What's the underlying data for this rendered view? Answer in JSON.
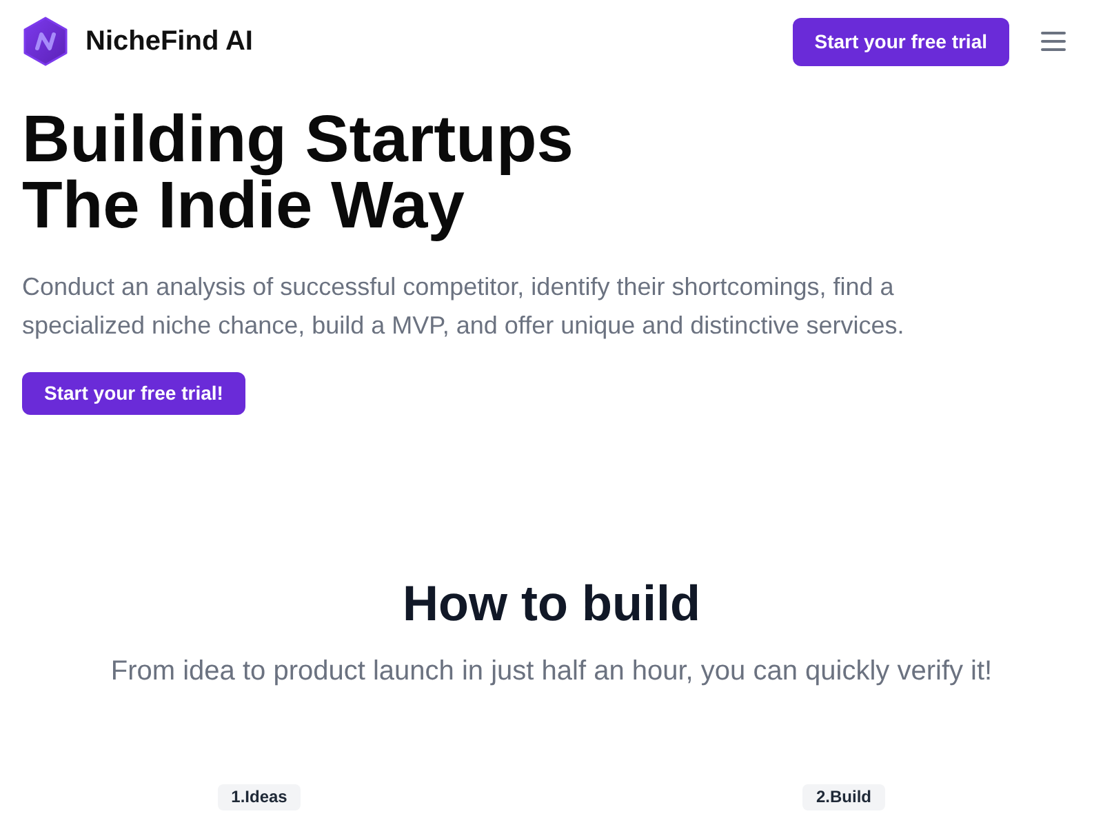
{
  "header": {
    "brand": "NicheFind AI",
    "cta": "Start your free trial"
  },
  "hero": {
    "title_lines": [
      "Building Startups",
      "The Indie Way"
    ],
    "description": "Conduct an analysis of successful competitor, identify their shortcomings, find a specialized niche chance, build a MVP, and offer unique and distinctive services.",
    "cta": "Start your free trial!"
  },
  "how_to_build": {
    "title": "How to build",
    "subtitle": "From idea to product launch in just half an hour, you can quickly verify it!",
    "steps": [
      {
        "label": "1.Ideas"
      },
      {
        "label": "2.Build"
      }
    ]
  }
}
